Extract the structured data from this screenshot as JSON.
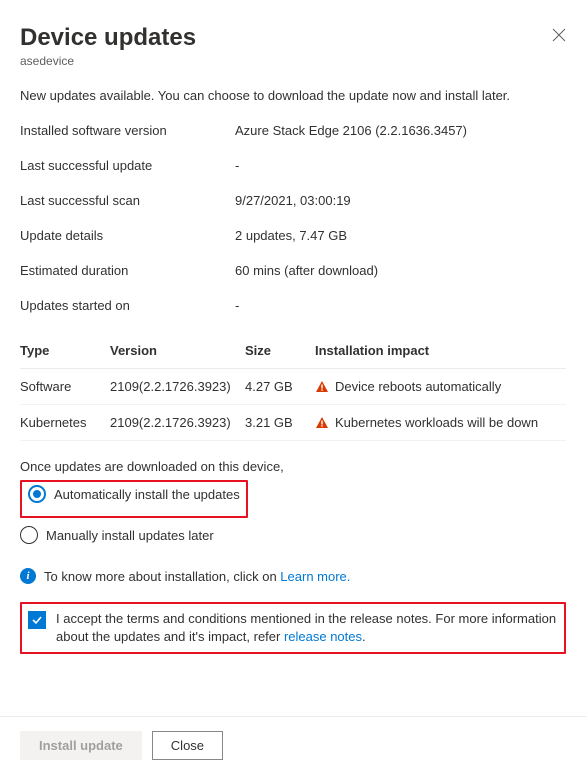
{
  "header": {
    "title": "Device updates",
    "subtitle": "asedevice"
  },
  "intro": "New updates available. You can choose to download the update now and install later.",
  "details": {
    "installed_software_version": {
      "label": "Installed software version",
      "value": "Azure Stack Edge 2106 (2.2.1636.3457)"
    },
    "last_successful_update": {
      "label": "Last successful update",
      "value": "-"
    },
    "last_successful_scan": {
      "label": "Last successful scan",
      "value": "9/27/2021, 03:00:19"
    },
    "update_details": {
      "label": "Update details",
      "value": "2 updates, 7.47 GB"
    },
    "estimated_duration": {
      "label": "Estimated duration",
      "value": "60 mins (after download)"
    },
    "updates_started_on": {
      "label": "Updates started on",
      "value": "-"
    }
  },
  "table": {
    "headers": {
      "type": "Type",
      "version": "Version",
      "size": "Size",
      "impact": "Installation impact"
    },
    "rows": [
      {
        "type": "Software",
        "version": "2109(2.2.1726.3923)",
        "size": "4.27 GB",
        "impact": "Device reboots automatically"
      },
      {
        "type": "Kubernetes",
        "version": "2109(2.2.1726.3923)",
        "size": "3.21 GB",
        "impact": "Kubernetes workloads will be down"
      }
    ]
  },
  "install_options": {
    "prompt": "Once updates are downloaded on this device,",
    "auto": "Automatically install the updates",
    "manual": "Manually install updates later"
  },
  "info": {
    "text": "To know more about installation, click on ",
    "link": "Learn more."
  },
  "terms": {
    "text1": "I accept the terms and conditions mentioned in the release notes. For more information about the updates and it's impact, refer ",
    "link": "release notes",
    "suffix": "."
  },
  "buttons": {
    "install": "Install update",
    "close": "Close"
  }
}
